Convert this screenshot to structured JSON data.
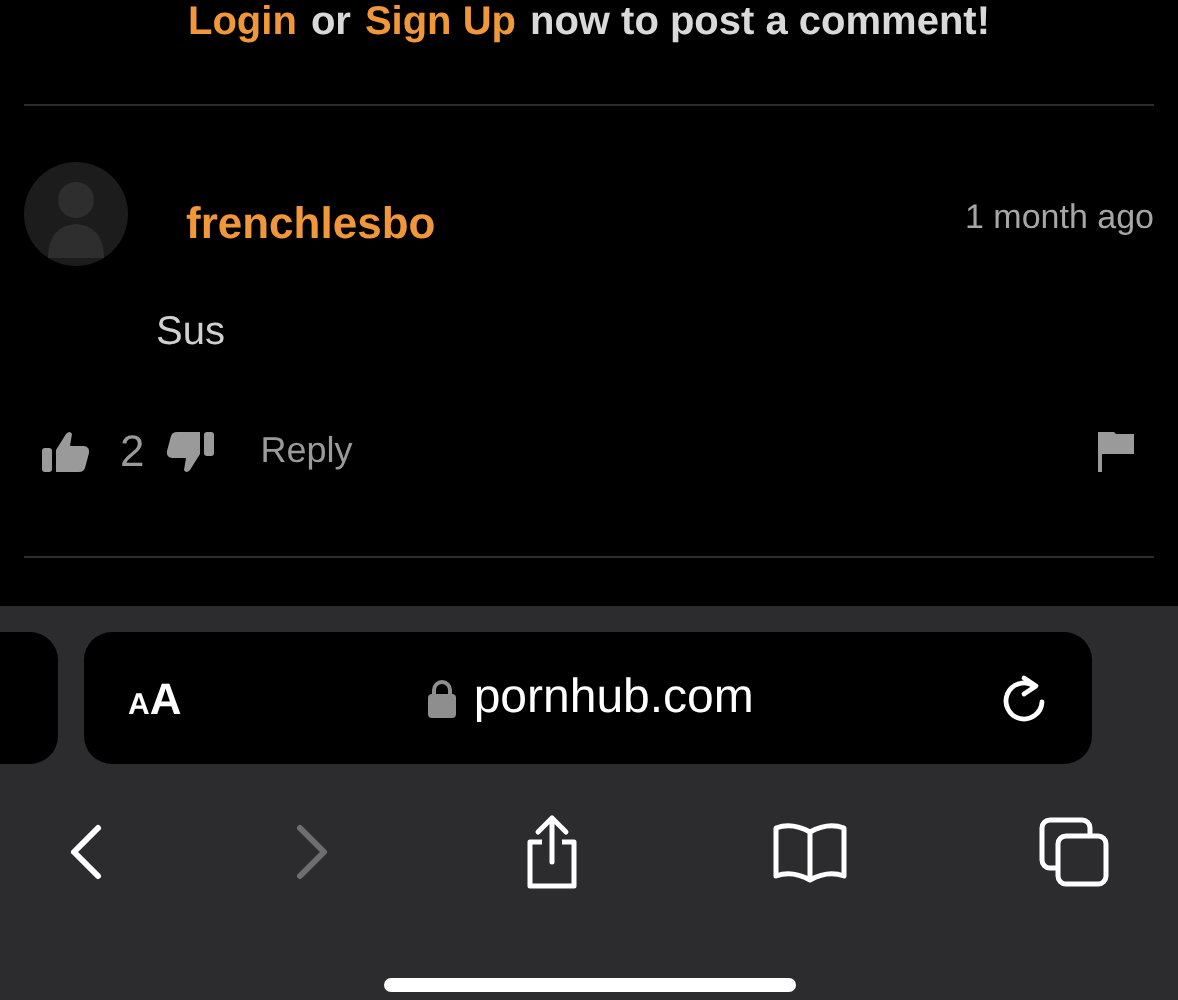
{
  "login_prompt": [
    {
      "kind": "link",
      "text": "Login"
    },
    {
      "kind": "text",
      "text": "or"
    },
    {
      "kind": "link",
      "text": "Sign Up"
    },
    {
      "kind": "text",
      "text": "now to post a comment!"
    }
  ],
  "comment": {
    "username": "frenchlesbo",
    "time": "1 month ago",
    "body": "Sus",
    "votes": "2",
    "reply": "Reply"
  },
  "address_bar": {
    "text_size": "AA",
    "secure": true,
    "url": "pornhub.com"
  },
  "toolbar": {
    "back": {
      "disabled": false
    },
    "forward": {
      "disabled": true
    }
  }
}
